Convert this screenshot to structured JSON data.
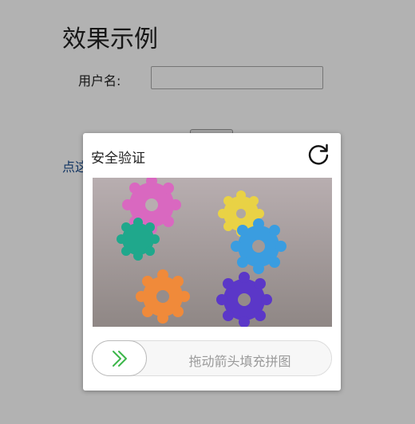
{
  "page": {
    "title": "效果示例",
    "username_label": "用户名:",
    "link_text": "点这里"
  },
  "modal": {
    "title": "安全验证",
    "refresh_icon": "refresh-icon",
    "image_alt": "colorful-gear-toys-puzzle",
    "slider_text": "拖动箭头填充拼图",
    "slider_icon": "double-chevron-right-icon",
    "accent_color": "#3cb64a"
  }
}
